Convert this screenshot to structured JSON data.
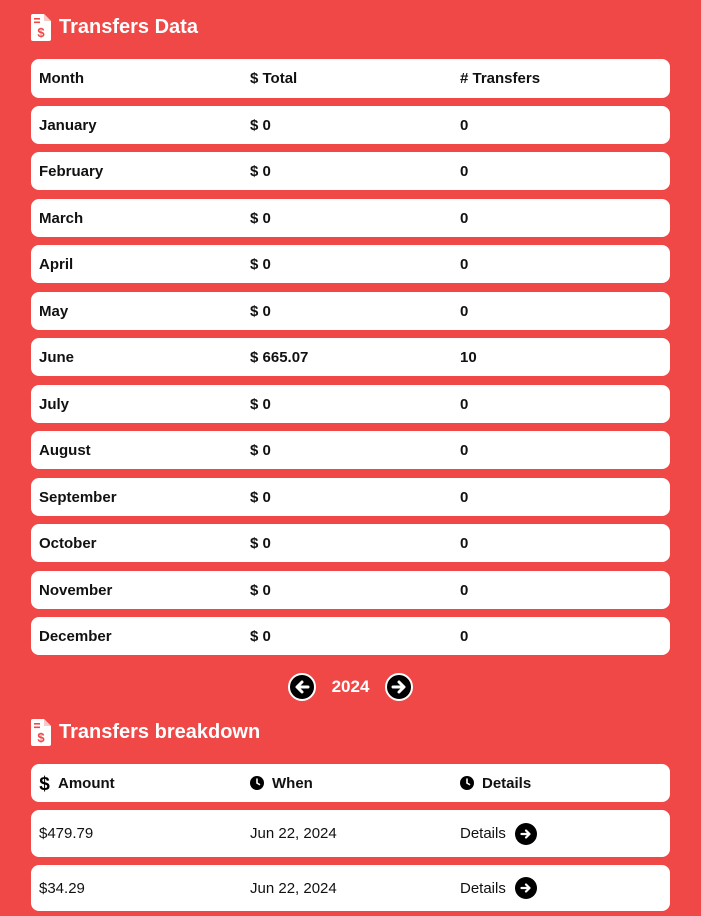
{
  "transfers_data": {
    "title": "Transfers Data",
    "headers": {
      "month": "Month",
      "total": "$ Total",
      "count": "# Transfers"
    },
    "rows": [
      {
        "month": "January",
        "total": "$ 0",
        "count": "0"
      },
      {
        "month": "February",
        "total": "$ 0",
        "count": "0"
      },
      {
        "month": "March",
        "total": "$ 0",
        "count": "0"
      },
      {
        "month": "April",
        "total": "$ 0",
        "count": "0"
      },
      {
        "month": "May",
        "total": "$ 0",
        "count": "0"
      },
      {
        "month": "June",
        "total": "$ 665.07",
        "count": "10"
      },
      {
        "month": "July",
        "total": "$ 0",
        "count": "0"
      },
      {
        "month": "August",
        "total": "$ 0",
        "count": "0"
      },
      {
        "month": "September",
        "total": "$ 0",
        "count": "0"
      },
      {
        "month": "October",
        "total": "$ 0",
        "count": "0"
      },
      {
        "month": "November",
        "total": "$ 0",
        "count": "0"
      },
      {
        "month": "December",
        "total": "$ 0",
        "count": "0"
      }
    ]
  },
  "year_nav": {
    "year": "2024",
    "prev_icon": "arrow-left-icon",
    "next_icon": "arrow-right-icon"
  },
  "transfers_breakdown": {
    "title": "Transfers breakdown",
    "headers": {
      "amount": "Amount",
      "when": "When",
      "details": "Details"
    },
    "rows": [
      {
        "amount": "$479.79",
        "when": "Jun 22, 2024",
        "details": "Details"
      },
      {
        "amount": "$34.29",
        "when": "Jun 22, 2024",
        "details": "Details"
      }
    ]
  },
  "colors": {
    "background": "#f04747",
    "card": "#ffffff",
    "button": "#000000"
  }
}
